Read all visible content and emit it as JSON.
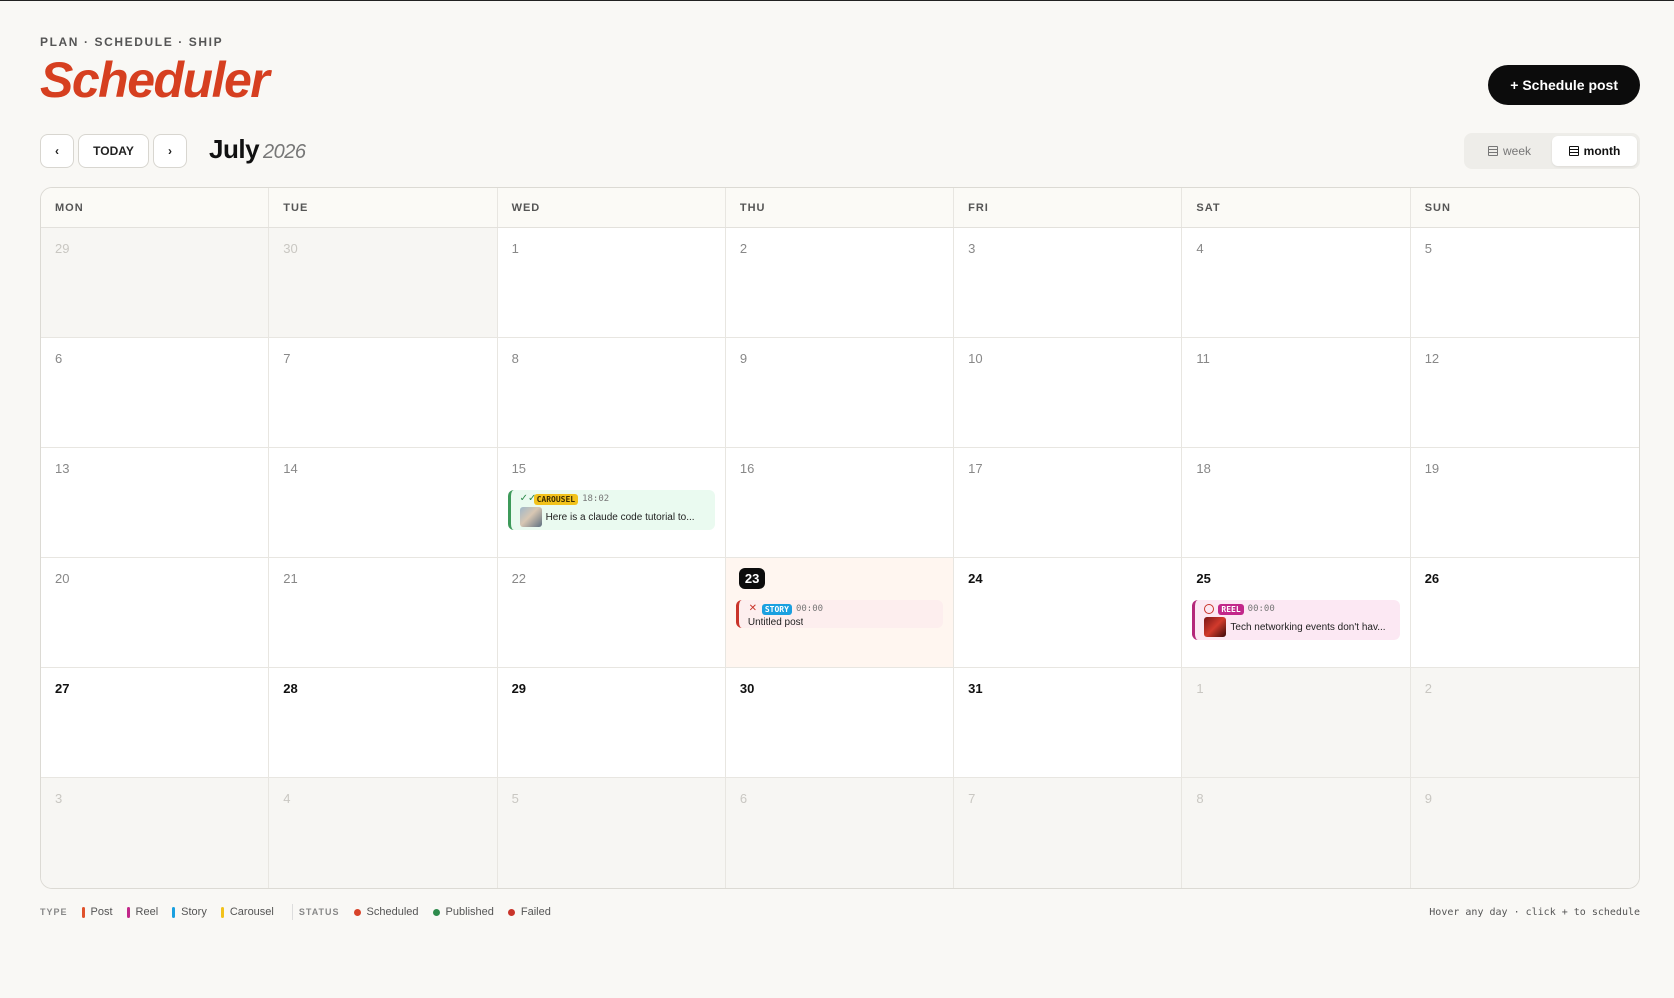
{
  "header": {
    "eyebrow": "PLAN · SCHEDULE · SHIP",
    "title": "Scheduler",
    "schedule_button": "+ Schedule post"
  },
  "toolbar": {
    "prev": "‹",
    "today": "TODAY",
    "next": "›",
    "month": "July",
    "year": "2026",
    "views": [
      {
        "label": "week",
        "active": false
      },
      {
        "label": "month",
        "active": true
      }
    ]
  },
  "weekdays": [
    "MON",
    "TUE",
    "WED",
    "THU",
    "FRI",
    "SAT",
    "SUN"
  ],
  "weeks": [
    [
      {
        "n": "29",
        "outside": true
      },
      {
        "n": "30",
        "outside": true
      },
      {
        "n": "1"
      },
      {
        "n": "2"
      },
      {
        "n": "3"
      },
      {
        "n": "4"
      },
      {
        "n": "5"
      }
    ],
    [
      {
        "n": "6"
      },
      {
        "n": "7"
      },
      {
        "n": "8"
      },
      {
        "n": "9"
      },
      {
        "n": "10"
      },
      {
        "n": "11"
      },
      {
        "n": "12"
      }
    ],
    [
      {
        "n": "13"
      },
      {
        "n": "14"
      },
      {
        "n": "15",
        "event": 0
      },
      {
        "n": "16"
      },
      {
        "n": "17"
      },
      {
        "n": "18"
      },
      {
        "n": "19"
      }
    ],
    [
      {
        "n": "20"
      },
      {
        "n": "21"
      },
      {
        "n": "22"
      },
      {
        "n": "23",
        "today": true,
        "event": 1
      },
      {
        "n": "24",
        "bold": true
      },
      {
        "n": "25",
        "bold": true,
        "event": 2
      },
      {
        "n": "26",
        "bold": true
      }
    ],
    [
      {
        "n": "27",
        "bold": true
      },
      {
        "n": "28",
        "bold": true
      },
      {
        "n": "29",
        "bold": true
      },
      {
        "n": "30",
        "bold": true
      },
      {
        "n": "31",
        "bold": true
      },
      {
        "n": "1",
        "outside": true
      },
      {
        "n": "2",
        "outside": true
      }
    ],
    [
      {
        "n": "3",
        "outside": true
      },
      {
        "n": "4",
        "outside": true
      },
      {
        "n": "5",
        "outside": true
      },
      {
        "n": "6",
        "outside": true
      },
      {
        "n": "7",
        "outside": true
      },
      {
        "n": "8",
        "outside": true
      },
      {
        "n": "9",
        "outside": true
      }
    ]
  ],
  "events": [
    {
      "type": "CAROUSEL",
      "type_class": "carousel",
      "status": "published",
      "status_icon": "✓✓",
      "time": "18:02",
      "text": "Here is a claude code tutorial to...",
      "thumb": "t1",
      "tone": "green"
    },
    {
      "type": "STORY",
      "type_class": "story",
      "status": "failed",
      "status_icon": "✕",
      "time": "00:00",
      "text": "Untitled post",
      "thumb": null,
      "tone": "red"
    },
    {
      "type": "REEL",
      "type_class": "reel",
      "status": "scheduled",
      "status_icon": "",
      "time": "00:00",
      "text": "Tech networking events don't hav...",
      "thumb": "t2",
      "tone": "pink"
    }
  ],
  "legend": {
    "type_title": "TYPE",
    "types": [
      {
        "label": "Post",
        "color": "#e0522c"
      },
      {
        "label": "Reel",
        "color": "#c2278a"
      },
      {
        "label": "Story",
        "color": "#1aa0e0"
      },
      {
        "label": "Carousel",
        "color": "#f2c21b"
      }
    ],
    "status_title": "STATUS",
    "statuses": [
      {
        "label": "Scheduled",
        "color": "#d8432a"
      },
      {
        "label": "Published",
        "color": "#2e8b4c"
      },
      {
        "label": "Failed",
        "color": "#c9342a"
      }
    ],
    "hint": "Hover any day · click + to schedule"
  },
  "colors": {
    "accent": "#d63f20",
    "button_bg": "#0c0c0c",
    "background": "#f9f8f5"
  }
}
